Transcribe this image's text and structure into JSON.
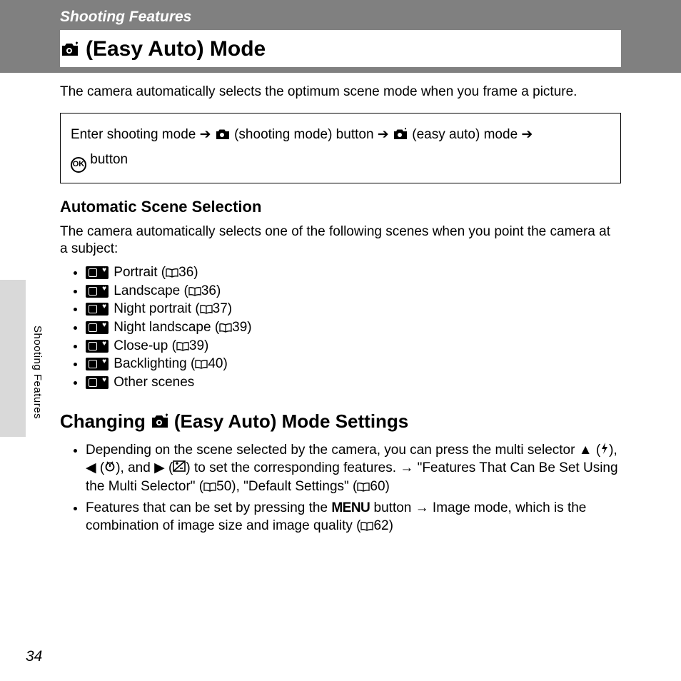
{
  "header": {
    "section_label": "Shooting Features",
    "title_suffix": "(Easy Auto) Mode"
  },
  "intro_text": "The camera automatically selects the optimum scene mode when you frame a picture.",
  "nav_box": {
    "part1": "Enter shooting mode",
    "part2": "(shooting mode) button",
    "part3": "(easy auto) mode",
    "part4": "button"
  },
  "auto_scene": {
    "heading": "Automatic Scene Selection",
    "desc": "The camera automatically selects one of the following scenes when you point the camera at a subject:",
    "items": [
      {
        "label": "Portrait",
        "page": "36"
      },
      {
        "label": "Landscape",
        "page": "36"
      },
      {
        "label": "Night portrait",
        "page": "37"
      },
      {
        "label": "Night landscape",
        "page": "39"
      },
      {
        "label": "Close-up",
        "page": "39"
      },
      {
        "label": "Backlighting",
        "page": "40"
      },
      {
        "label": "Other scenes",
        "page": ""
      }
    ]
  },
  "changing": {
    "heading_prefix": "Changing",
    "heading_suffix": "(Easy Auto) Mode Settings",
    "bullet1_a": "Depending on the scene selected by the camera, you can press the multi selector ",
    "bullet1_b": "), and ",
    "bullet1_c": ") to set the corresponding features. → \"Features That Can Be Set Using the Multi Selector\" (",
    "bullet1_d": "50), \"Default Settings\" (",
    "bullet1_e": "60)",
    "bullet2_a": "Features that can be set by pressing the ",
    "bullet2_b": " button → Image mode, which is the combination of image size and image quality (",
    "bullet2_c": "62)",
    "menu_label": "MENU"
  },
  "side_label": "Shooting Features",
  "page_number": "34"
}
